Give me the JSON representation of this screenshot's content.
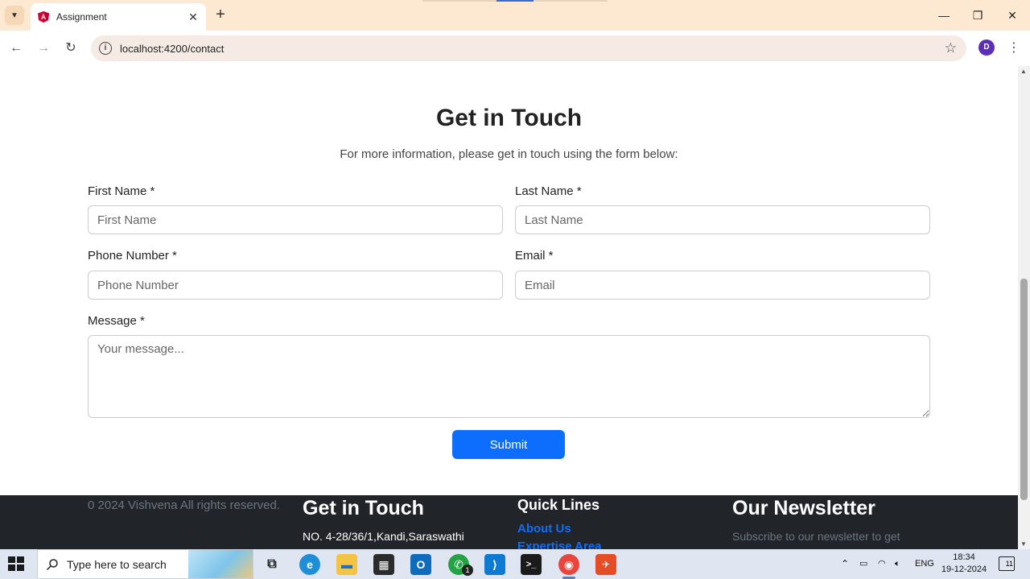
{
  "browser": {
    "tab_title": "Assignment",
    "url": "localhost:4200/contact",
    "profile_initial": "D"
  },
  "page": {
    "heading": "Get in Touch",
    "subheading": "For more information, please get in touch using the form below:",
    "form": {
      "first_name_label": "First Name *",
      "first_name_placeholder": "First Name",
      "last_name_label": "Last Name *",
      "last_name_placeholder": "Last Name",
      "phone_label": "Phone Number *",
      "phone_placeholder": "Phone Number",
      "email_label": "Email *",
      "email_placeholder": "Email",
      "message_label": "Message *",
      "message_placeholder": "Your message...",
      "submit_label": "Submit"
    },
    "footer": {
      "copyright": "0 2024 Vishvena All rights reserved.",
      "contact_heading": "Get in Touch",
      "address": "NO. 4-28/36/1,Kandi,Saraswathi",
      "quick_heading": "Quick Lines",
      "links": [
        "About Us",
        "Expertise Area"
      ],
      "newsletter_heading": "Our Newsletter",
      "newsletter_text": "Subscribe to our newsletter to get"
    }
  },
  "taskbar": {
    "search_placeholder": "Type here to search",
    "whatsapp_badge": "1",
    "language": "ENG",
    "time": "18:34",
    "date": "19-12-2024",
    "notification_count": "11"
  },
  "colors": {
    "primary": "#0d6efd",
    "footer_bg": "#212529",
    "chrome_bg": "#fde9d2"
  }
}
